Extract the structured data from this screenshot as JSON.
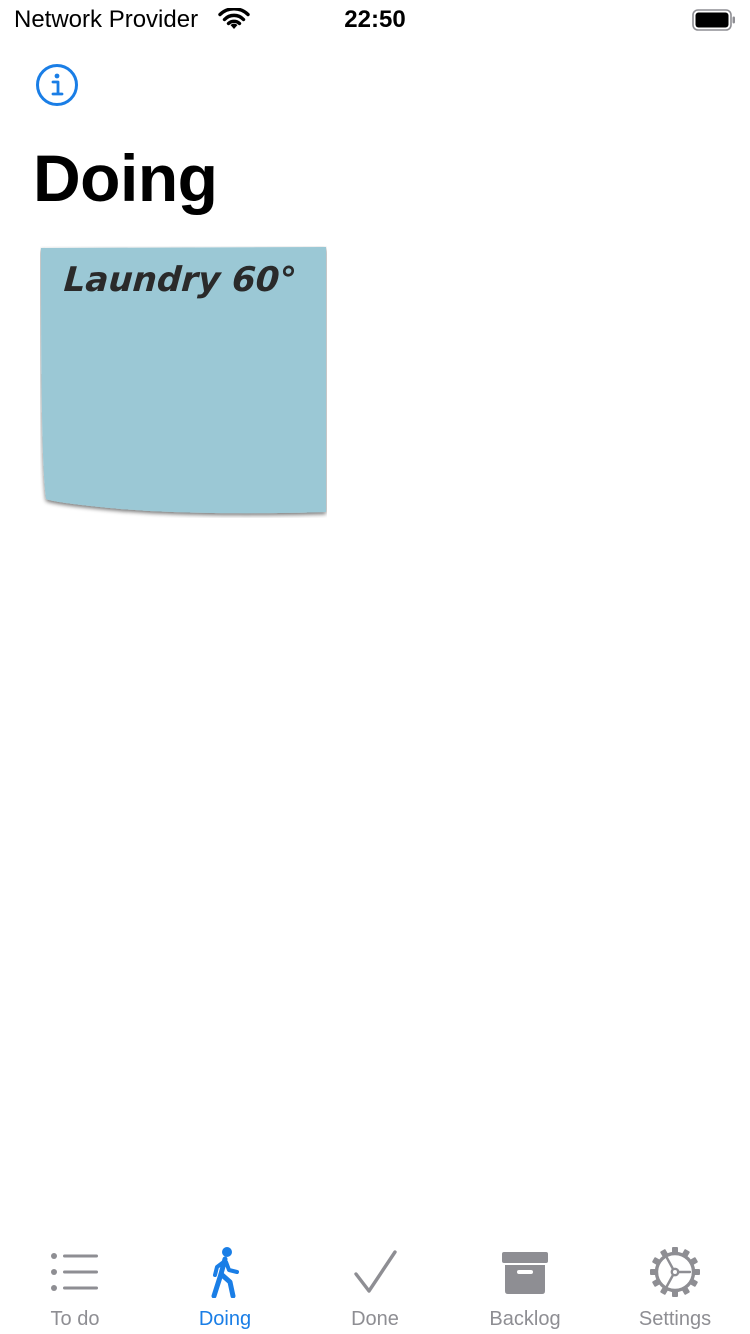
{
  "status_bar": {
    "carrier": "Network Provider",
    "time": "22:50"
  },
  "header": {
    "title": "Doing"
  },
  "notes": [
    {
      "text": "Laundry 60°",
      "color": "#9bc8d5"
    }
  ],
  "tab_bar": {
    "active_color": "#1a7ee6",
    "inactive_color": "#8e8e93",
    "tabs": [
      {
        "label": "To do",
        "icon": "list-icon",
        "active": false
      },
      {
        "label": "Doing",
        "icon": "walking-person-icon",
        "active": true
      },
      {
        "label": "Done",
        "icon": "checkmark-icon",
        "active": false
      },
      {
        "label": "Backlog",
        "icon": "archive-box-icon",
        "active": false
      },
      {
        "label": "Settings",
        "icon": "gear-icon",
        "active": false
      }
    ]
  }
}
